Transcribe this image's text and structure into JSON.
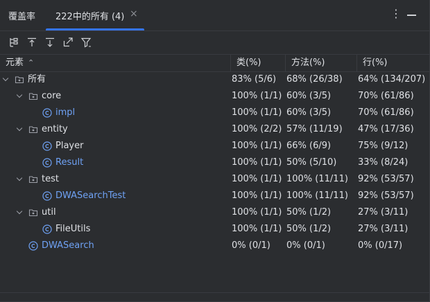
{
  "header": {
    "tool_title": "覆盖率",
    "tab_label": "222中的所有 (4)",
    "close_glyph": "×",
    "more_glyph": "⋮"
  },
  "columns": {
    "element": "元素",
    "class": "类(%)",
    "method": "方法(%)",
    "line": "行(%)"
  },
  "sort": "ascending",
  "rows": [
    {
      "name": "所有",
      "kind": "folder",
      "indent": 0,
      "expanded": true,
      "class": "83% (5/6)",
      "method": "68% (26/38)",
      "line": "64% (134/207)"
    },
    {
      "name": "core",
      "kind": "folder",
      "indent": 1,
      "expanded": true,
      "class": "100% (1/1)",
      "method": "60% (3/5)",
      "line": "70% (61/86)"
    },
    {
      "name": "impl",
      "kind": "class",
      "indent": 2,
      "class": "100% (1/1)",
      "method": "60% (3/5)",
      "line": "70% (61/86)"
    },
    {
      "name": "entity",
      "kind": "folder",
      "indent": 1,
      "expanded": true,
      "class": "100% (2/2)",
      "method": "57% (11/19)",
      "line": "47% (17/36)"
    },
    {
      "name": "Player",
      "kind": "class-plain",
      "indent": 2,
      "class": "100% (1/1)",
      "method": "66% (6/9)",
      "line": "75% (9/12)"
    },
    {
      "name": "Result",
      "kind": "class",
      "indent": 2,
      "class": "100% (1/1)",
      "method": "50% (5/10)",
      "line": "33% (8/24)"
    },
    {
      "name": "test",
      "kind": "folder",
      "indent": 1,
      "expanded": true,
      "class": "100% (1/1)",
      "method": "100% (11/11)",
      "line": "92% (53/57)"
    },
    {
      "name": "DWASearchTest",
      "kind": "class",
      "indent": 2,
      "class": "100% (1/1)",
      "method": "100% (11/11)",
      "line": "92% (53/57)"
    },
    {
      "name": "util",
      "kind": "folder",
      "indent": 1,
      "expanded": true,
      "class": "100% (1/1)",
      "method": "50% (1/2)",
      "line": "27% (3/11)"
    },
    {
      "name": "FileUtils",
      "kind": "class-plain",
      "indent": 2,
      "class": "100% (1/1)",
      "method": "50% (1/2)",
      "line": "27% (3/11)"
    },
    {
      "name": "DWASearch",
      "kind": "class",
      "indent": 1,
      "class": "0% (0/1)",
      "method": "0% (0/1)",
      "line": "0% (0/17)"
    }
  ],
  "colors": {
    "background": "#2b2d30",
    "accent": "#3574f0",
    "class_link": "#6fa2f5",
    "text": "#dfe1e5",
    "border": "#393b40"
  },
  "icons": {
    "toolbar": [
      "flatten-packages-icon",
      "import-icon",
      "export-icon",
      "autoscroll-icon",
      "filter-icon"
    ],
    "folder": "package-icon",
    "class": "class-icon"
  }
}
